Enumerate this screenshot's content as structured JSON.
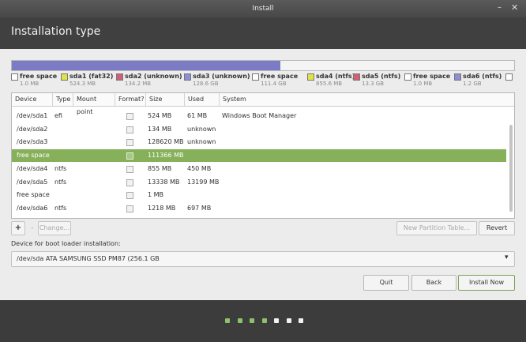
{
  "window": {
    "title": "Install",
    "minimize_glyph": "–",
    "close_glyph": "✕"
  },
  "header": {
    "title": "Installation type"
  },
  "partition_bar": [
    {
      "share": 0.535,
      "color": "#7c7cc6"
    },
    {
      "share": 0.465,
      "color": "#f4f4f4"
    }
  ],
  "legend": [
    {
      "name": "free space",
      "size": "1.0 MB",
      "color": "#ffffff"
    },
    {
      "name": "sda1 (fat32)",
      "size": "524.3 MB",
      "color": "#e0e24a"
    },
    {
      "name": "sda2 (unknown)",
      "size": "134.2 MB",
      "color": "#d25f73"
    },
    {
      "name": "sda3 (unknown)",
      "size": "128.6 GB",
      "color": "#8e8ed6"
    },
    {
      "name": "free space",
      "size": "111.4 GB",
      "color": "#ffffff"
    },
    {
      "name": "sda4 (ntfs)",
      "size": "855.6 MB",
      "color": "#e0e24a"
    },
    {
      "name": "sda5 (ntfs)",
      "size": "13.3 GB",
      "color": "#d25f73"
    },
    {
      "name": "free space",
      "size": "1.0 MB",
      "color": "#ffffff"
    },
    {
      "name": "sda6 (ntfs)",
      "size": "1.2 GB",
      "color": "#8e8ed6"
    },
    {
      "name": "",
      "size": "",
      "color": "#ffffff"
    }
  ],
  "table": {
    "columns": [
      "Device",
      "Type",
      "Mount point",
      "Format?",
      "Size",
      "Used",
      "System"
    ],
    "rows": [
      {
        "device": "/dev/sda1",
        "type": "efi",
        "mount": "",
        "size": "524 MB",
        "used": "61 MB",
        "system": "Windows Boot Manager",
        "selected": false
      },
      {
        "device": "/dev/sda2",
        "type": "",
        "mount": "",
        "size": "134 MB",
        "used": "unknown",
        "system": "",
        "selected": false
      },
      {
        "device": "/dev/sda3",
        "type": "",
        "mount": "",
        "size": "128620 MB",
        "used": "unknown",
        "system": "",
        "selected": false
      },
      {
        "device": "free space",
        "type": "",
        "mount": "",
        "size": "111366 MB",
        "used": "",
        "system": "",
        "selected": true
      },
      {
        "device": "/dev/sda4",
        "type": "ntfs",
        "mount": "",
        "size": "855 MB",
        "used": "450 MB",
        "system": "",
        "selected": false
      },
      {
        "device": "/dev/sda5",
        "type": "ntfs",
        "mount": "",
        "size": "13338 MB",
        "used": "13199 MB",
        "system": "",
        "selected": false
      },
      {
        "device": "free space",
        "type": "",
        "mount": "",
        "size": "1 MB",
        "used": "",
        "system": "",
        "selected": false
      },
      {
        "device": "/dev/sda6",
        "type": "ntfs",
        "mount": "",
        "size": "1218 MB",
        "used": "697 MB",
        "system": "",
        "selected": false
      }
    ]
  },
  "toolbar": {
    "add_label": "+",
    "remove_label": "–",
    "change_label": "Change...",
    "new_table_label": "New Partition Table...",
    "revert_label": "Revert"
  },
  "bootloader": {
    "label": "Device for boot loader installation:",
    "selected": "/dev/sda   ATA SAMSUNG SSD PM87 (256.1 GB",
    "arrow": "▾"
  },
  "buttons": {
    "quit": "Quit",
    "back": "Back",
    "install": "Install Now"
  },
  "progress": {
    "steps": 7,
    "done": 4,
    "done_color": "#8fc06a",
    "todo_color": "#f2f2f2"
  }
}
